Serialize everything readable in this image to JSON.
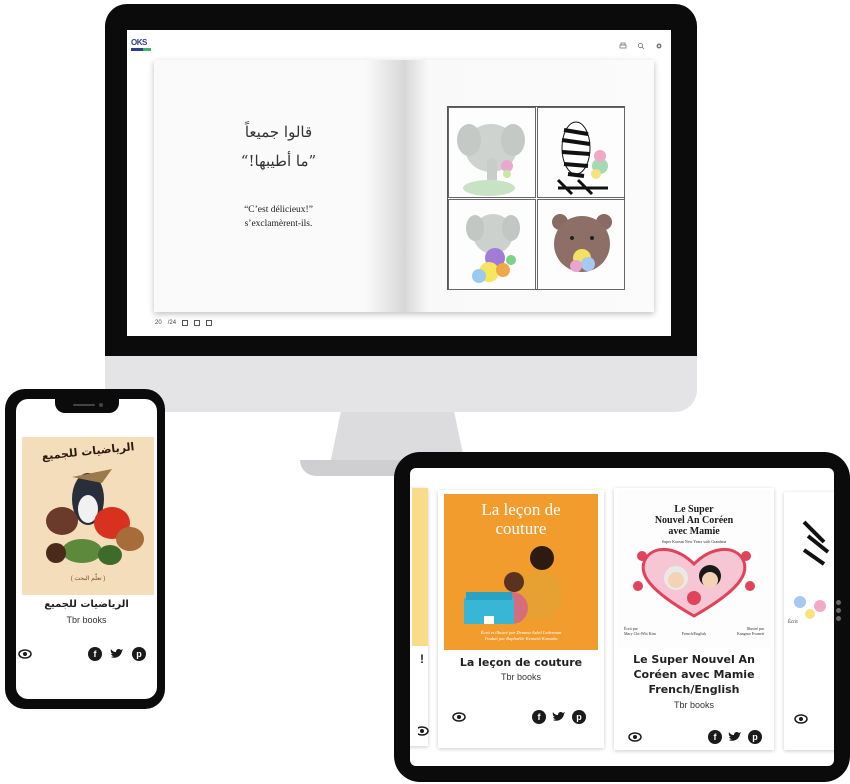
{
  "monitor": {
    "logo_text": "OKS",
    "top_tools": [
      "print-icon",
      "search-icon",
      "settings-icon"
    ],
    "arabic_line1": "قالوا جميعاً",
    "arabic_line2": "”ما أطيبها!“",
    "french_line1": "“C’est délicieux!”",
    "french_line2": "s’exclamèrent-ils.",
    "page_current": "20",
    "page_total": "/24"
  },
  "phone": {
    "cover_title": "الرياضيات للجميع",
    "cover_subtitle": "( تعلّم البحث )",
    "book_title": "الرياضيات للجميع",
    "author": "Tbr books"
  },
  "tablet": {
    "left_partial_text": "!",
    "card1": {
      "cover_title_line1": "La leçon de",
      "cover_title_line2": "couture",
      "cover_credit1": "Écrit et illustré par Deanna Ashel Lederman",
      "cover_credit2": "Traduit par Raphaëlle Kenneth Konsaku",
      "title": "La leçon de couture",
      "author": "Tbr books"
    },
    "card2": {
      "cover_title_line1": "Le Super",
      "cover_title_line2": "Nouvel An Coréen",
      "cover_title_line3": "avec Mamie",
      "cover_subtitle": "Super Korean New Years with Grandma",
      "cover_credit_left1": "Écrit par",
      "cover_credit_left2": "Mary Chi-Whi Kim",
      "cover_credit_mid": "French/English",
      "cover_credit_right1": "Illustré par",
      "cover_credit_right2": "Kangmo Evanett",
      "title_line1": "Le Super Nouvel An",
      "title_line2": "Coréen avec Mamie",
      "title_line3": "French/English",
      "author": "Tbr books"
    },
    "right_partial_text": "Écrit"
  },
  "colors": {
    "device_black": "#0b0b0b",
    "monitor_chin": "#e4e4e6",
    "couture_orange": "#f29c2e",
    "phone_cover_bg": "#f4ddbb"
  }
}
